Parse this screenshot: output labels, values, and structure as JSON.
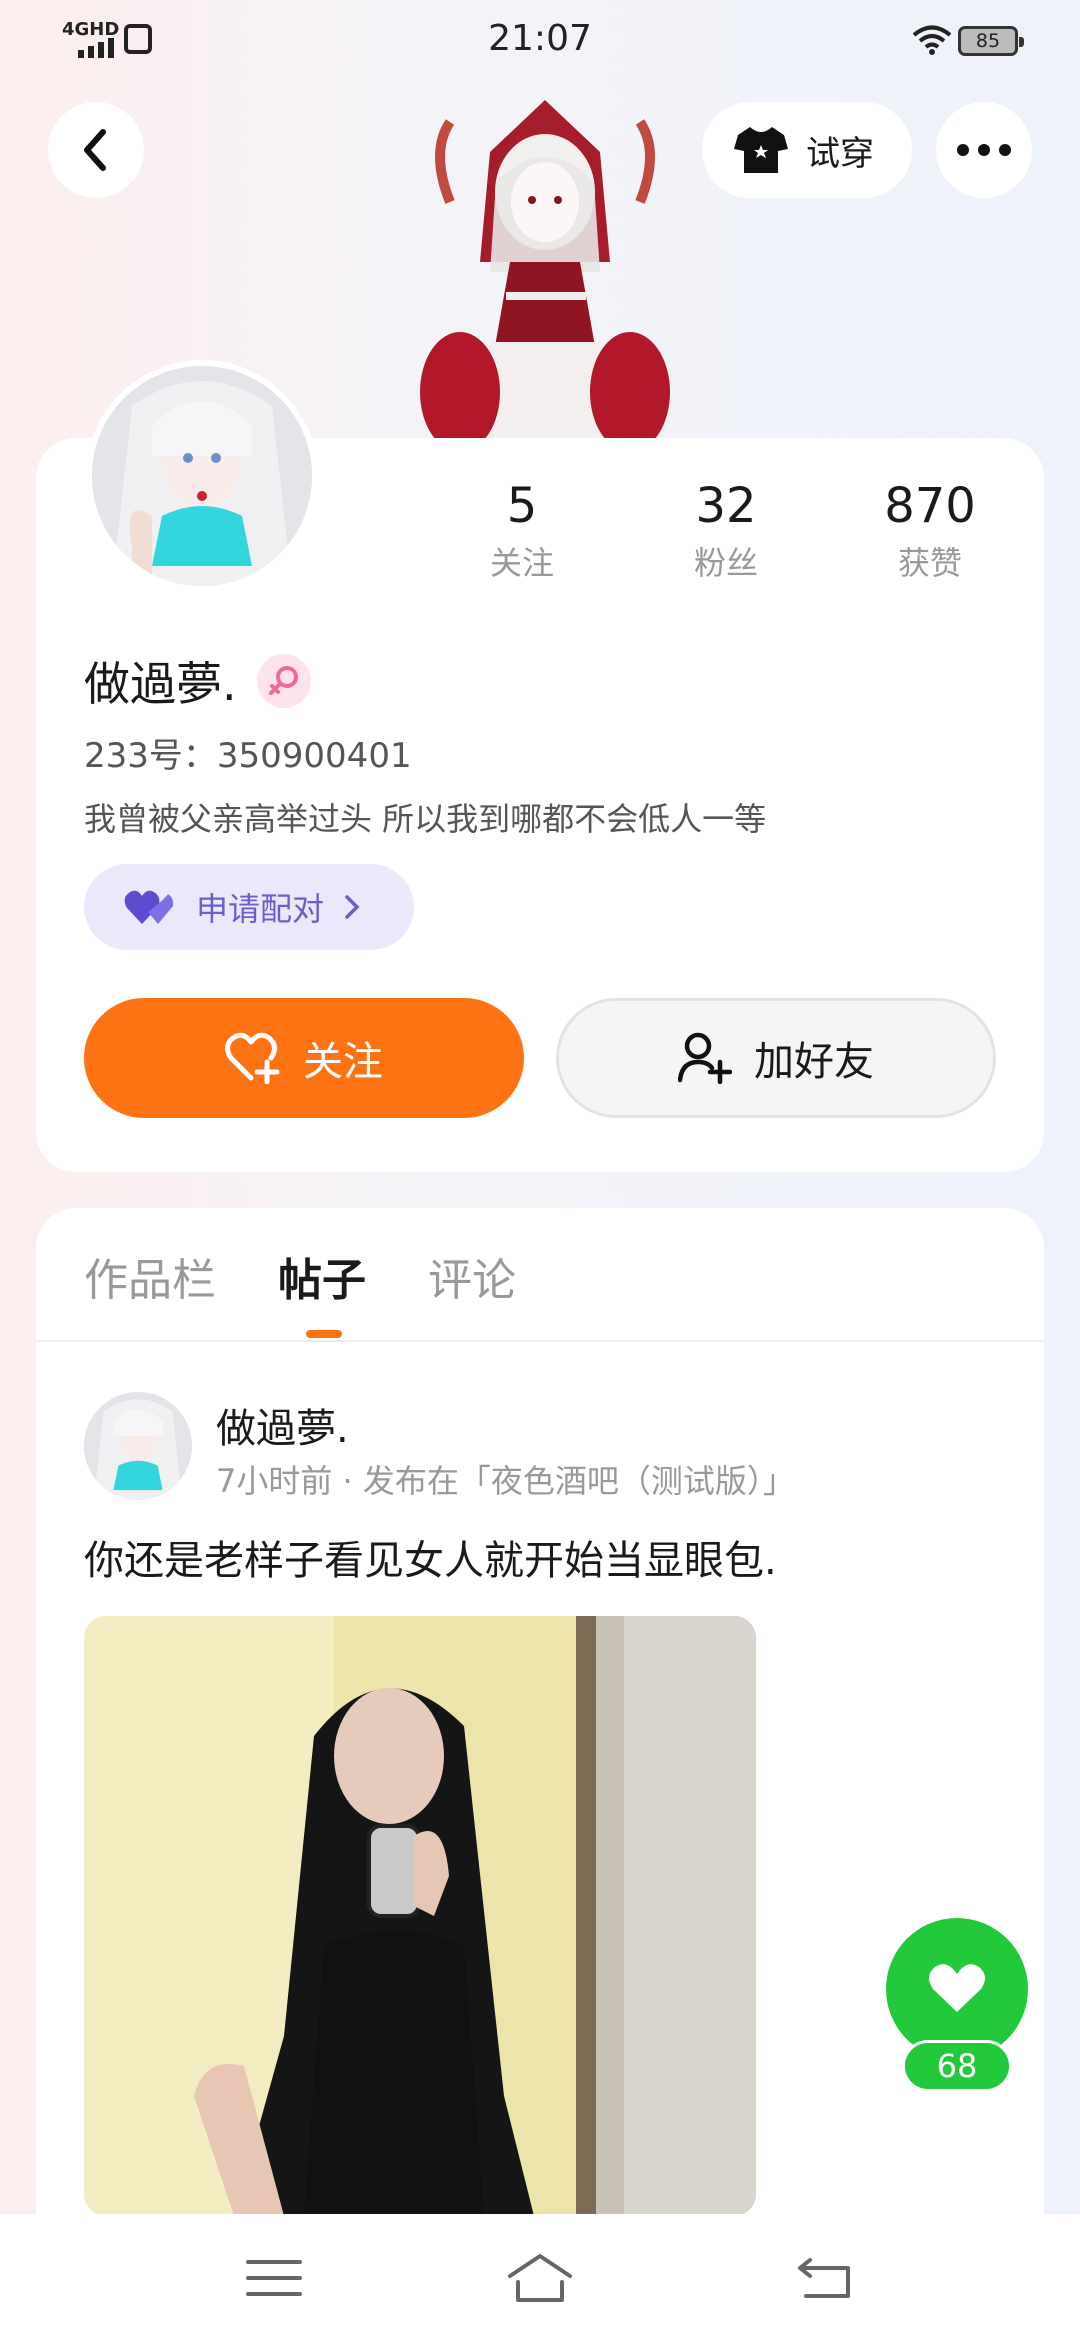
{
  "status_bar": {
    "network": "4GHD",
    "time": "21:07",
    "battery": "85"
  },
  "header": {
    "tryon_label": "试穿"
  },
  "profile": {
    "stats": [
      {
        "value": "5",
        "label": "关注"
      },
      {
        "value": "32",
        "label": "粉丝"
      },
      {
        "value": "870",
        "label": "获赞"
      }
    ],
    "username": "做過夢.",
    "uid": "233号：350900401",
    "bio": "我曾被父亲高举过头 所以我到哪都不会低人一等",
    "match_label": "申请配对",
    "follow_label": "关注",
    "add_friend_label": "加好友"
  },
  "tabs": [
    {
      "label": "作品栏"
    },
    {
      "label": "帖子"
    },
    {
      "label": "评论"
    }
  ],
  "post": {
    "author": "做過夢.",
    "meta": "7小时前 · 发布在「夜色酒吧（测试版）」",
    "text": "你还是老样子看见女人就开始当显眼包.",
    "likes": "68"
  },
  "colors": {
    "accent": "#fd7314",
    "like": "#22c93b",
    "match_bg": "#ebe8fb",
    "match_text": "#6a5ec9"
  },
  "icons": {
    "back": "chevron-left-icon",
    "tryon": "tshirt-icon",
    "more": "more-dots-icon",
    "gender": "female-icon",
    "match": "hearts-icon",
    "follow": "heart-plus-icon",
    "add_friend": "user-plus-icon",
    "like": "heart-icon"
  }
}
